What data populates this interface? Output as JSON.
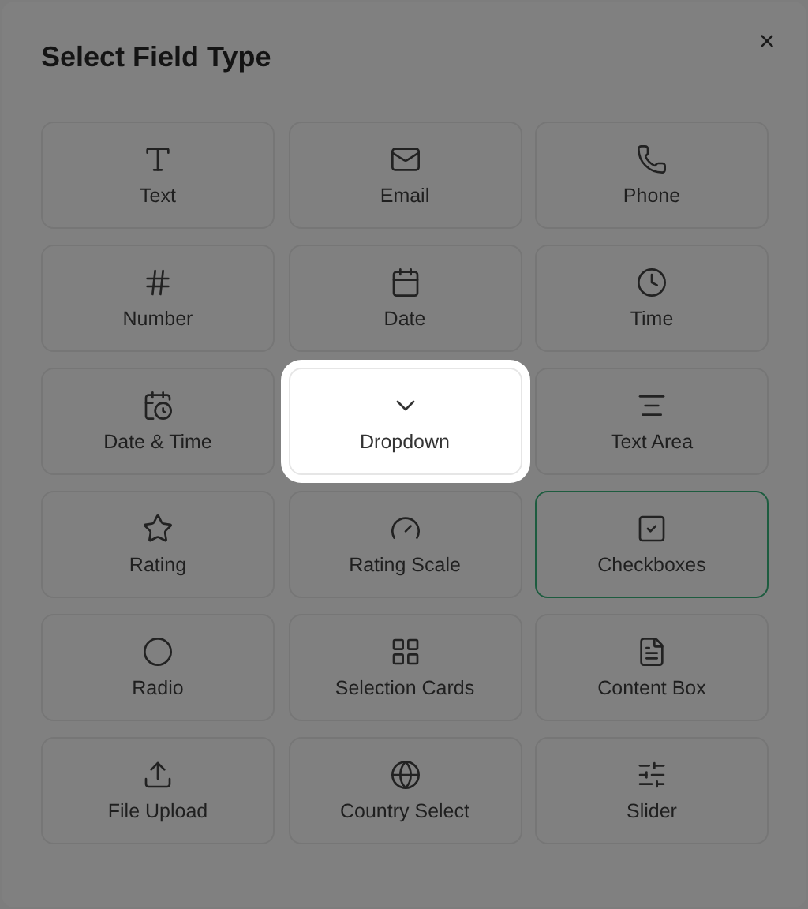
{
  "dialog": {
    "title": "Select Field Type",
    "close": "×"
  },
  "field_types": [
    {
      "label": "Text",
      "selected": false,
      "highlighted": false
    },
    {
      "label": "Email",
      "selected": false,
      "highlighted": false
    },
    {
      "label": "Phone",
      "selected": false,
      "highlighted": false
    },
    {
      "label": "Number",
      "selected": false,
      "highlighted": false
    },
    {
      "label": "Date",
      "selected": false,
      "highlighted": false
    },
    {
      "label": "Time",
      "selected": false,
      "highlighted": false
    },
    {
      "label": "Date & Time",
      "selected": false,
      "highlighted": false
    },
    {
      "label": "Dropdown",
      "selected": false,
      "highlighted": true
    },
    {
      "label": "Text Area",
      "selected": false,
      "highlighted": false
    },
    {
      "label": "Rating",
      "selected": false,
      "highlighted": false
    },
    {
      "label": "Rating Scale",
      "selected": false,
      "highlighted": false
    },
    {
      "label": "Checkboxes",
      "selected": true,
      "highlighted": false
    },
    {
      "label": "Radio",
      "selected": false,
      "highlighted": false
    },
    {
      "label": "Selection Cards",
      "selected": false,
      "highlighted": false
    },
    {
      "label": "Content Box",
      "selected": false,
      "highlighted": false
    },
    {
      "label": "File Upload",
      "selected": false,
      "highlighted": false
    },
    {
      "label": "Country Select",
      "selected": false,
      "highlighted": false
    },
    {
      "label": "Slider",
      "selected": false,
      "highlighted": false
    }
  ]
}
